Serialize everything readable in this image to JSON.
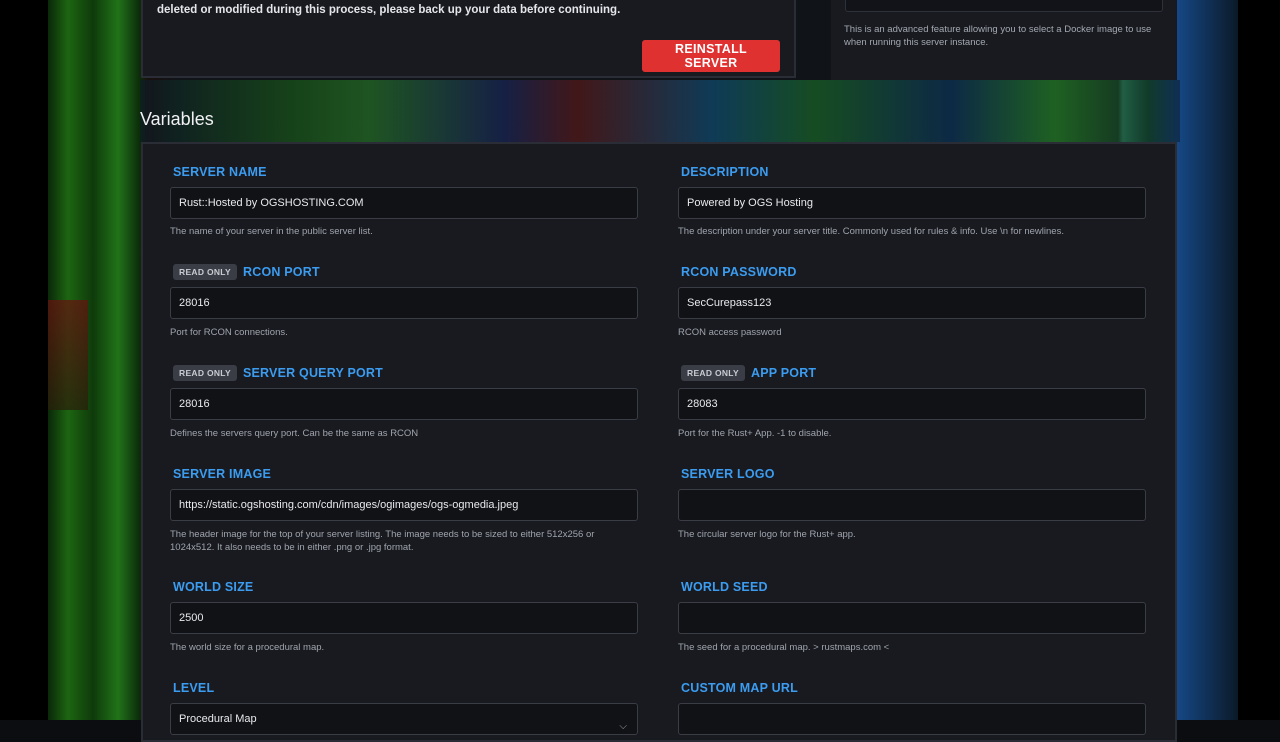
{
  "reinstall": {
    "warning": "deleted or modified during this process, please back up your data before continuing.",
    "button_label": "REINSTALL SERVER"
  },
  "docker": {
    "help": "This is an advanced feature allowing you to select a Docker image to use when running this server instance."
  },
  "section_title": "Variables",
  "read_only_badge": "READ ONLY",
  "fields": {
    "server_name": {
      "label": "SERVER NAME",
      "value": "Rust::Hosted by OGSHOSTING.COM",
      "help": "The name of your server in the public server list."
    },
    "description": {
      "label": "DESCRIPTION",
      "value": "Powered by OGS Hosting",
      "help": "The description under your server title. Commonly used for rules & info. Use \\n for newlines."
    },
    "rcon_port": {
      "label": "RCON PORT",
      "value": "28016",
      "help": "Port for RCON connections."
    },
    "rcon_password": {
      "label": "RCON PASSWORD",
      "value": "SecCurepass123",
      "help": "RCON access password"
    },
    "server_query_port": {
      "label": "SERVER QUERY PORT",
      "value": "28016",
      "help": "Defines the servers query port. Can be the same as RCON"
    },
    "app_port": {
      "label": "APP PORT",
      "value": "28083",
      "help": "Port for the Rust+ App. -1 to disable."
    },
    "server_image": {
      "label": "SERVER IMAGE",
      "value": "https://static.ogshosting.com/cdn/images/ogimages/ogs-ogmedia.jpeg",
      "help": "The header image for the top of your server listing. The image needs to be sized to either 512x256 or 1024x512. It also needs to be in either .png or .jpg format."
    },
    "server_logo": {
      "label": "SERVER LOGO",
      "value": "",
      "help": "The circular server logo for the Rust+ app."
    },
    "world_size": {
      "label": "WORLD SIZE",
      "value": "2500",
      "help": "The world size for a procedural map."
    },
    "world_seed": {
      "label": "WORLD SEED",
      "value": "",
      "help": "The seed for a procedural map. > rustmaps.com <"
    },
    "level": {
      "label": "LEVEL",
      "value": "Procedural Map"
    },
    "custom_map_url": {
      "label": "CUSTOM MAP URL",
      "value": ""
    }
  }
}
